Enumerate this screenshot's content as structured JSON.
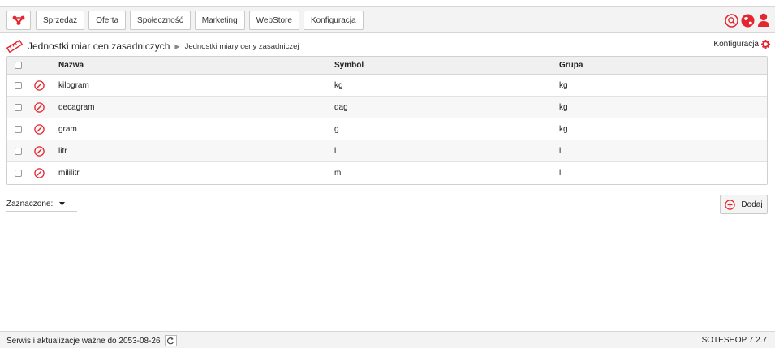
{
  "nav": {
    "items": [
      {
        "label": "Sprzedaż"
      },
      {
        "label": "Oferta"
      },
      {
        "label": "Społeczność"
      },
      {
        "label": "Marketing"
      },
      {
        "label": "WebStore"
      },
      {
        "label": "Konfiguracja"
      }
    ]
  },
  "header_icons": [
    "search-icon",
    "globe-icon",
    "user-icon"
  ],
  "breadcrumb": {
    "main": "Jednostki miar cen zasadniczych",
    "sub": "Jednostki miary ceny zasadniczej"
  },
  "config_link": "Konfiguracja",
  "table": {
    "headers": {
      "name": "Nazwa",
      "symbol": "Symbol",
      "group": "Grupa"
    },
    "rows": [
      {
        "name": "kilogram",
        "symbol": "kg",
        "group": "kg"
      },
      {
        "name": "decagram",
        "symbol": "dag",
        "group": "kg"
      },
      {
        "name": "gram",
        "symbol": "g",
        "group": "kg"
      },
      {
        "name": "litr",
        "symbol": "l",
        "group": "l"
      },
      {
        "name": "mililitr",
        "symbol": "ml",
        "group": "l"
      }
    ]
  },
  "selected_dropdown": "Zaznaczone:",
  "add_button": "Dodaj",
  "footer": {
    "left": "Serwis i aktualizacje ważne do 2053-08-26",
    "right": "SOTESHOP 7.2.7"
  },
  "colors": {
    "accent": "#e3262f"
  }
}
